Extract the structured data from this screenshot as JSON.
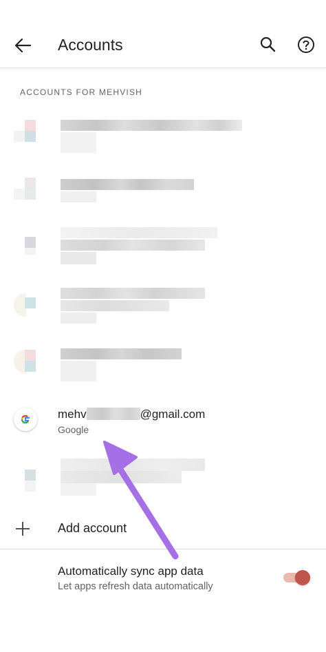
{
  "appbar": {
    "title": "Accounts",
    "back_icon": "arrow-back-icon",
    "search_icon": "search-icon",
    "help_icon": "help-icon"
  },
  "section": {
    "header": "ACCOUNTS FOR MEHVISH"
  },
  "accounts": [
    {
      "state": "pixelated"
    },
    {
      "state": "pixelated"
    },
    {
      "state": "pixelated"
    },
    {
      "state": "pixelated"
    },
    {
      "state": "pixelated"
    },
    {
      "email_prefix": "mehv",
      "email_suffix": "@gmail.com",
      "provider": "Google",
      "icon": "google-logo-icon"
    },
    {
      "state": "pixelated"
    }
  ],
  "add_account": {
    "label": "Add account",
    "icon": "plus-icon"
  },
  "sync": {
    "title": "Automatically sync app data",
    "subtitle": "Let apps refresh data automatically",
    "enabled": true
  },
  "colors": {
    "accent": "#c0544a",
    "annotation_arrow": "#a56fe6"
  }
}
